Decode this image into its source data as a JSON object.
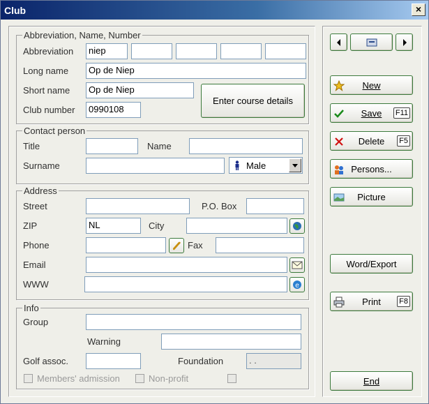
{
  "window": {
    "title": "Club",
    "close": "×"
  },
  "identity": {
    "legend": "Abbreviation, Name, Number",
    "abbreviation_label": "Abbreviation",
    "abbreviation_value": "niep",
    "long_name_label": "Long name",
    "long_name_value": "Op de Niep",
    "short_name_label": "Short name",
    "short_name_value": "Op de Niep",
    "club_number_label": "Club number",
    "club_number_value": "0990108",
    "course_button": "Enter course details"
  },
  "contact": {
    "legend": "Contact person",
    "title_label": "Title",
    "name_label": "Name",
    "surname_label": "Surname",
    "gender_value": "Male"
  },
  "address": {
    "legend": "Address",
    "street_label": "Street",
    "pobox_label": "P.O. Box",
    "zip_label": "ZIP",
    "zip_value": "NL",
    "city_label": "City",
    "phone_label": "Phone",
    "fax_label": "Fax",
    "email_label": "Email",
    "www_label": "WWW"
  },
  "info": {
    "legend": "Info",
    "group_label": "Group",
    "warning_label": "Warning",
    "golf_assoc_label": "Golf assoc.",
    "foundation_label": "Foundation",
    "foundation_value": ". .",
    "members_admission_label": "Members' admission",
    "nonprofit_label": "Non-profit"
  },
  "actions": {
    "new_label": "New",
    "save_label": "Save",
    "save_key": "F11",
    "delete_label": "Delete",
    "delete_key": "F5",
    "persons_label": "Persons...",
    "picture_label": "Picture",
    "word_export_label": "Word/Export",
    "print_label": "Print",
    "print_key": "F8",
    "end_label": "End"
  },
  "colors": {
    "title_bar": "#0a246a",
    "button_border": "#3c7a3c",
    "input_border": "#7f9db9"
  }
}
